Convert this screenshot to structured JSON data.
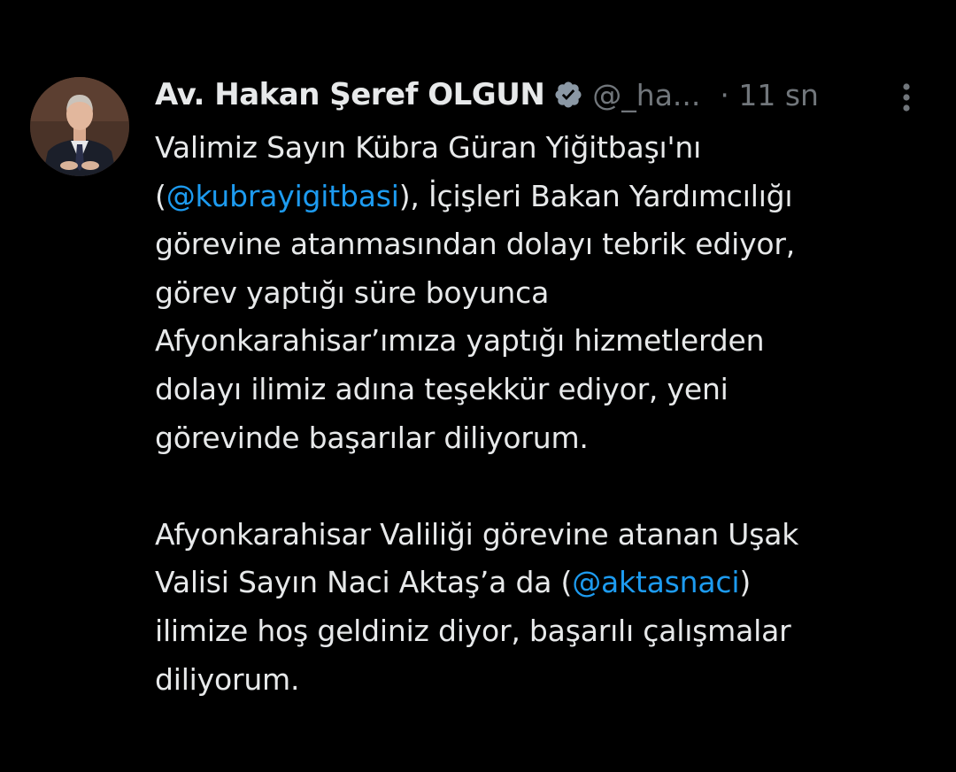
{
  "tweet": {
    "author": {
      "display_name": "Av. Hakan Şeref OLGUN",
      "handle": "@_ha...",
      "verified_icon": "verified-badge-icon",
      "avatar": "avatar"
    },
    "time": "· 11 sn",
    "more_icon": "more-options-icon",
    "paragraph1": {
      "l1": "Valimiz Sayın Kübra Güran Yiğitbaşı'nı",
      "l2_open": "(",
      "l2_mention": "@kubrayigitbasi",
      "l2_rest": "), İçişleri Bakan Yardımcılığı",
      "l3": "görevine atanmasından dolayı tebrik ediyor,",
      "l4": "görev yaptığı süre boyunca",
      "l5": "Afyonkarahisar’ımıza yaptığı hizmetlerden",
      "l6": "dolayı ilimiz adına teşekkür ediyor, yeni",
      "l7": "görevinde başarılar diliyorum."
    },
    "paragraph2": {
      "l1": "Afyonkarahisar Valiliği görevine atanan Uşak",
      "l2_pre": "Valisi Sayın Naci Aktaş’a da (",
      "l2_mention": "@aktasnaci",
      "l2_post": ")",
      "l3": "ilimize hoş geldiniz diyor, başarılı çalışmalar",
      "l4": "diliyorum."
    }
  },
  "colors": {
    "background": "#000000",
    "text": "#e7e9ea",
    "secondary": "#71767b",
    "link": "#1d9bf0"
  }
}
